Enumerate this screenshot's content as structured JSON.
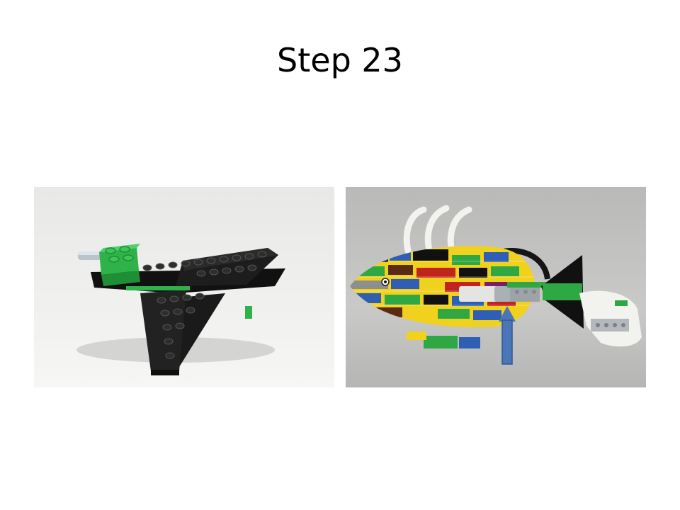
{
  "slide": {
    "title": "Step 23"
  },
  "images": {
    "left": {
      "icon": "lego-tail-fin-assembly-photo"
    },
    "right": {
      "icon": "lego-fish-model-photo",
      "annotation": "blue-up-arrow"
    }
  },
  "colors": {
    "background": "#ffffff",
    "arrow": "#4a76b8",
    "lego_black": "#1c1c1c",
    "lego_green": "#2fb24a"
  }
}
